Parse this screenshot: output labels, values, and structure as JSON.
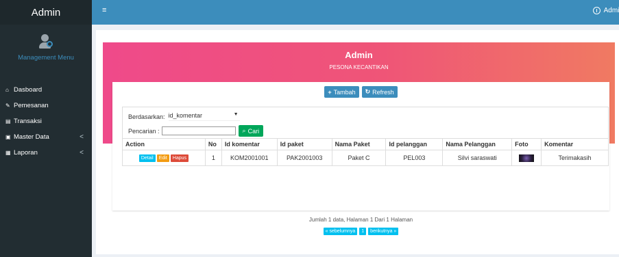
{
  "sidebar": {
    "brand": "Admin",
    "menu_title": "Management Menu",
    "items": [
      {
        "label": "Dasboard",
        "icon": "home-icon",
        "glyph": "⌂",
        "has_children": false
      },
      {
        "label": "Pemesanan",
        "icon": "pencil-icon",
        "glyph": "✎",
        "has_children": false
      },
      {
        "label": "Transaksi",
        "icon": "book-icon",
        "glyph": "▤",
        "has_children": false
      },
      {
        "label": "Master Data",
        "icon": "edit-icon",
        "glyph": "▣",
        "has_children": true
      },
      {
        "label": "Laporan",
        "icon": "calendar-icon",
        "glyph": "▦",
        "has_children": true
      }
    ],
    "chevron": "<"
  },
  "topbar": {
    "menu_glyph": "≡",
    "user_label": "Admin"
  },
  "hero": {
    "title": "Admin",
    "subtitle": "PESONA KECANTIKAN"
  },
  "toolbar": {
    "add_label": "Tambah",
    "add_glyph": "+",
    "refresh_label": "Refresh",
    "refresh_glyph": "↻"
  },
  "search": {
    "filter_label": "Berdasarkan:",
    "filter_value": "id_komentar",
    "filter_arrow": "▼",
    "query_label": "Pencarian :",
    "query_value": "",
    "button_label": "Cari",
    "button_glyph": "⌕"
  },
  "table": {
    "headers": [
      "Action",
      "No",
      "Id komentar",
      "Id paket",
      "Nama Paket",
      "Id pelanggan",
      "Nama Pelanggan",
      "Foto",
      "Komentar"
    ],
    "rows": [
      {
        "actions": [
          "Detail",
          "Edit",
          "Hapus"
        ],
        "no": "1",
        "id_komentar": "KOM2001001",
        "id_paket": "PAK2001003",
        "nama_paket": "Paket C",
        "id_pelanggan": "PEL003",
        "nama_pelanggan": "Silvi saraswati",
        "komentar": "Terimakasih"
      }
    ]
  },
  "summary": "Jumlah 1 data, Halaman 1 Dari 1 Halaman",
  "pagination": {
    "prev": "« sebelumnya",
    "current": "1",
    "next": "berikutnya »"
  },
  "colors": {
    "sidebar": "#222d32",
    "topbar": "#3c8dbc",
    "hero_start": "#ef4a8a",
    "hero_end": "#f07a62",
    "primary": "#3c8dbc",
    "success": "#00a65a",
    "info": "#00c0ef",
    "warning": "#f39c12",
    "danger": "#dd4b39"
  }
}
